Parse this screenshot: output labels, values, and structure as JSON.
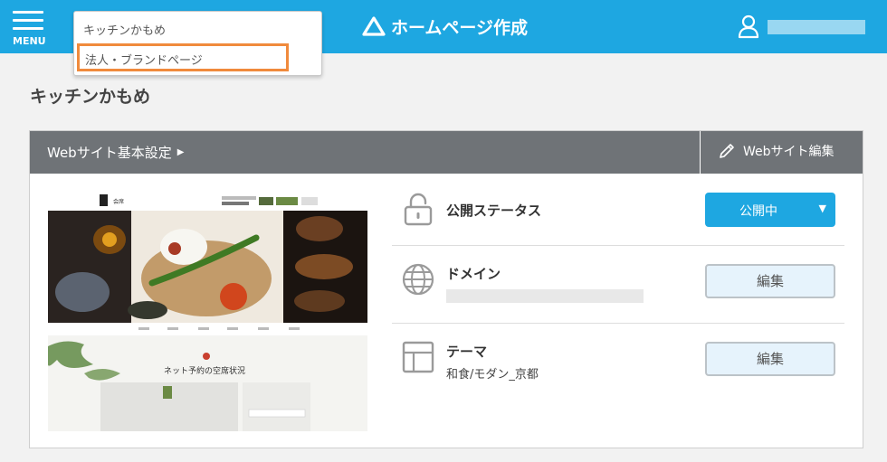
{
  "header": {
    "menu_label": "MENU",
    "app_title": "ホームページ作成"
  },
  "site_dropdown": {
    "current": "キッチンかもめ",
    "highlighted_option": "法人・ブランドページ"
  },
  "page_title": "キッチンかもめ",
  "panel": {
    "settings_title": "Webサイト基本設定",
    "edit_site_label": "Webサイト編集",
    "rows": {
      "status": {
        "label": "公開ステータス",
        "button": "公開中"
      },
      "domain": {
        "label": "ドメイン",
        "button": "編集"
      },
      "theme": {
        "label": "テーマ",
        "value": "和食/モダン_京都",
        "button": "編集"
      }
    }
  },
  "preview": {
    "logo_text": "会席",
    "reservation_heading": "ネット予約の空席状況"
  },
  "colors": {
    "header_bg": "#1ea7e1",
    "panel_head_bg": "#6f7377",
    "highlight_border": "#f08a3c",
    "edit_button_bg": "#e6f3fc"
  },
  "icons": {
    "menu": "hamburger-icon",
    "brand": "triangle-logo-icon",
    "user": "user-icon",
    "edit": "pencil-icon",
    "status": "lock-open-icon",
    "domain": "globe-icon",
    "theme": "layout-icon"
  }
}
